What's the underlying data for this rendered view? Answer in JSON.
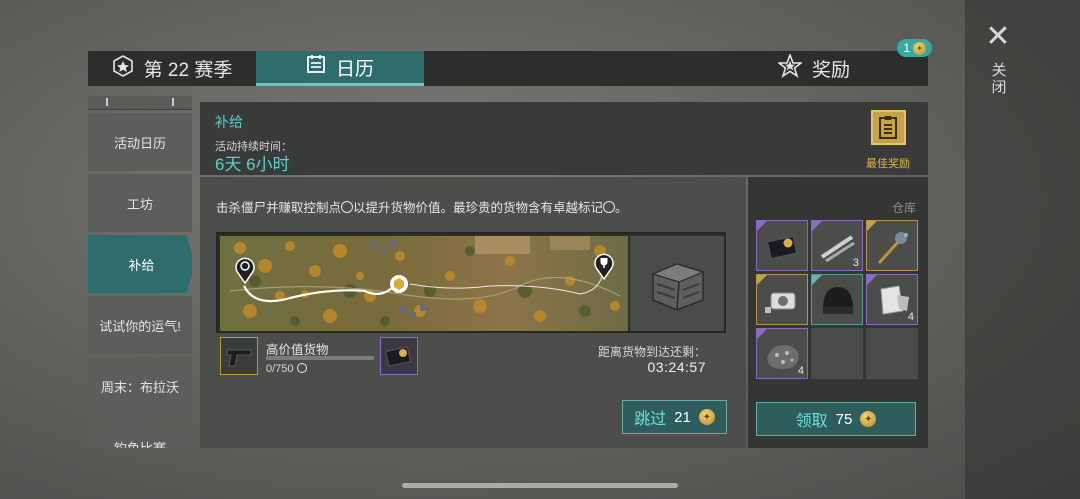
{
  "close": {
    "label": "关闭",
    "icon": "close-icon"
  },
  "tabs": {
    "season": {
      "label": "第 22 赛季",
      "icon": "season-badge-icon"
    },
    "calendar": {
      "label": "日历",
      "icon": "calendar-icon",
      "active": true
    },
    "rewards": {
      "label": "奖励",
      "icon": "star-icon",
      "badge_count": "1",
      "badge_icon": "coin-icon"
    }
  },
  "sidebar": {
    "items": [
      {
        "label": "活动日历"
      },
      {
        "label": "工坊"
      },
      {
        "label": "补给",
        "active": true
      },
      {
        "label": "试试你的运气!"
      },
      {
        "label": "周末：布拉沃"
      },
      {
        "label": "钓鱼比赛"
      }
    ]
  },
  "event": {
    "title": "补给",
    "duration_label": "活动持续时间：",
    "duration": "6天 6小时",
    "best_reward_label": "最佳奖励",
    "description_a": "击杀僵尸并赚取控制点",
    "description_b": "以提升货物价值。最珍贵的货物含有卓越标记",
    "description_c": "。"
  },
  "cargo": {
    "title": "高价值货物",
    "progress": "0/750",
    "progress_fraction": 0,
    "eta_label": "距离货物到达还剩：",
    "eta": "03:24:57"
  },
  "skip": {
    "label": "跳过",
    "cost": "21"
  },
  "warehouse": {
    "title": "仓库",
    "slots": [
      {
        "icon": "card-icon",
        "rarity": "purple",
        "count": ""
      },
      {
        "icon": "pipes-icon",
        "rarity": "purple",
        "count": "3"
      },
      {
        "icon": "mace-icon",
        "rarity": "gold",
        "count": ""
      },
      {
        "icon": "canister-icon",
        "rarity": "gold",
        "count": ""
      },
      {
        "icon": "beanie-icon",
        "rarity": "teal",
        "count": ""
      },
      {
        "icon": "scrap-icon",
        "rarity": "purple",
        "count": "4"
      },
      {
        "icon": "ore-icon",
        "rarity": "purple",
        "count": "4"
      },
      {
        "icon": "",
        "rarity": "empty",
        "count": ""
      },
      {
        "icon": "",
        "rarity": "empty",
        "count": ""
      }
    ]
  },
  "claim": {
    "label": "领取",
    "cost": "75"
  },
  "colors": {
    "accent": "#5ed0cc",
    "tab_active": "#2f6c6c",
    "gold": "#e0b84e",
    "purple": "#8b6ac2"
  }
}
